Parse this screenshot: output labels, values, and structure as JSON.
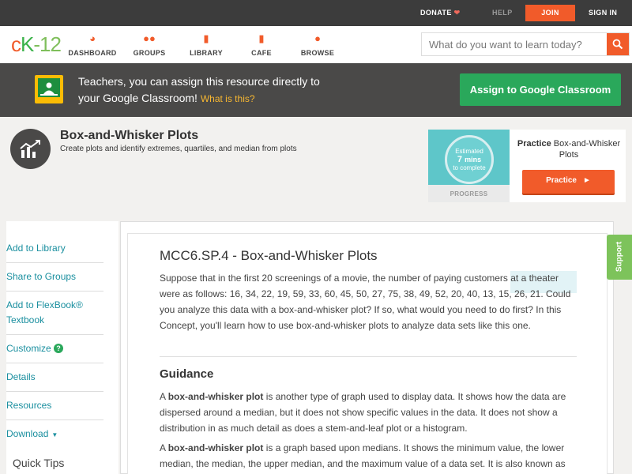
{
  "topbar": {
    "donate": "DONATE",
    "help": "HELP",
    "join": "JOIN",
    "signin": "SIGN IN"
  },
  "nav": {
    "logo_c": "c",
    "logo_k": "K",
    "logo_n": "-12",
    "items": [
      {
        "label": "DASHBOARD",
        "icon": "dashboard-icon"
      },
      {
        "label": "GROUPS",
        "icon": "groups-icon"
      },
      {
        "label": "LIBRARY",
        "icon": "library-icon"
      },
      {
        "label": "CAFE",
        "icon": "cafe-icon"
      },
      {
        "label": "BROWSE",
        "icon": "browse-icon"
      }
    ],
    "search_placeholder": "What do you want to learn today?"
  },
  "classroom": {
    "line1": "Teachers, you can assign this resource directly to",
    "line2": "your Google Classroom!",
    "what": "What is this?",
    "button": "Assign to Google Classroom"
  },
  "concept": {
    "title": "Box-and-Whisker Plots",
    "subtitle": "Create plots and identify extremes, quartiles, and median from plots"
  },
  "practice": {
    "estimated": "Estimated",
    "mins": "7",
    "mins_label": "mins",
    "to_complete": "to complete",
    "progress": "PROGRESS",
    "title_bold": "Practice",
    "title_rest": "Box-and-Whisker Plots",
    "button": "Practice"
  },
  "sidebar": {
    "items": [
      "Add to Library",
      "Share to Groups",
      "Add to FlexBook® Textbook",
      "Customize",
      "Details",
      "Resources",
      "Download"
    ],
    "quick_tips": "Quick Tips"
  },
  "main": {
    "title": "MCC6.SP.4 - Box-and-Whisker Plots",
    "intro": "Suppose that in the first 20 screenings of a movie, the number of paying customers at a theater were as follows: 16, 34, 22, 19, 59, 33, 60, 45, 50, 27, 75, 38, 49, 52, 20, 40, 13, 15, 26, 21. Could you analyze this data with a box-and-whisker plot? If so, what would you need to do first? In this Concept, you'll learn how to use box-and-whisker plots to analyze data sets like this one.",
    "guidance": "Guidance",
    "p1_a": "A ",
    "p1_bold": "box-and-whisker plot",
    "p1_b": " is another type of graph used to display data. It shows how the data are dispersed around a median, but it does not show specific values in the data. It does not show a distribution in as much detail as does a stem-and-leaf plot or a histogram.",
    "p2_a": "A ",
    "p2_bold": "box-and-whisker plot",
    "p2_b": " is a graph based upon medians. It shows the minimum value, the lower median, the median, the upper median, and the maximum value of a data set. It is also known as"
  },
  "support": "Support",
  "colors": {
    "accent": "#f15b2a",
    "green": "#2aa85b",
    "teal": "#1a8f9f",
    "dark": "#4a4948"
  }
}
